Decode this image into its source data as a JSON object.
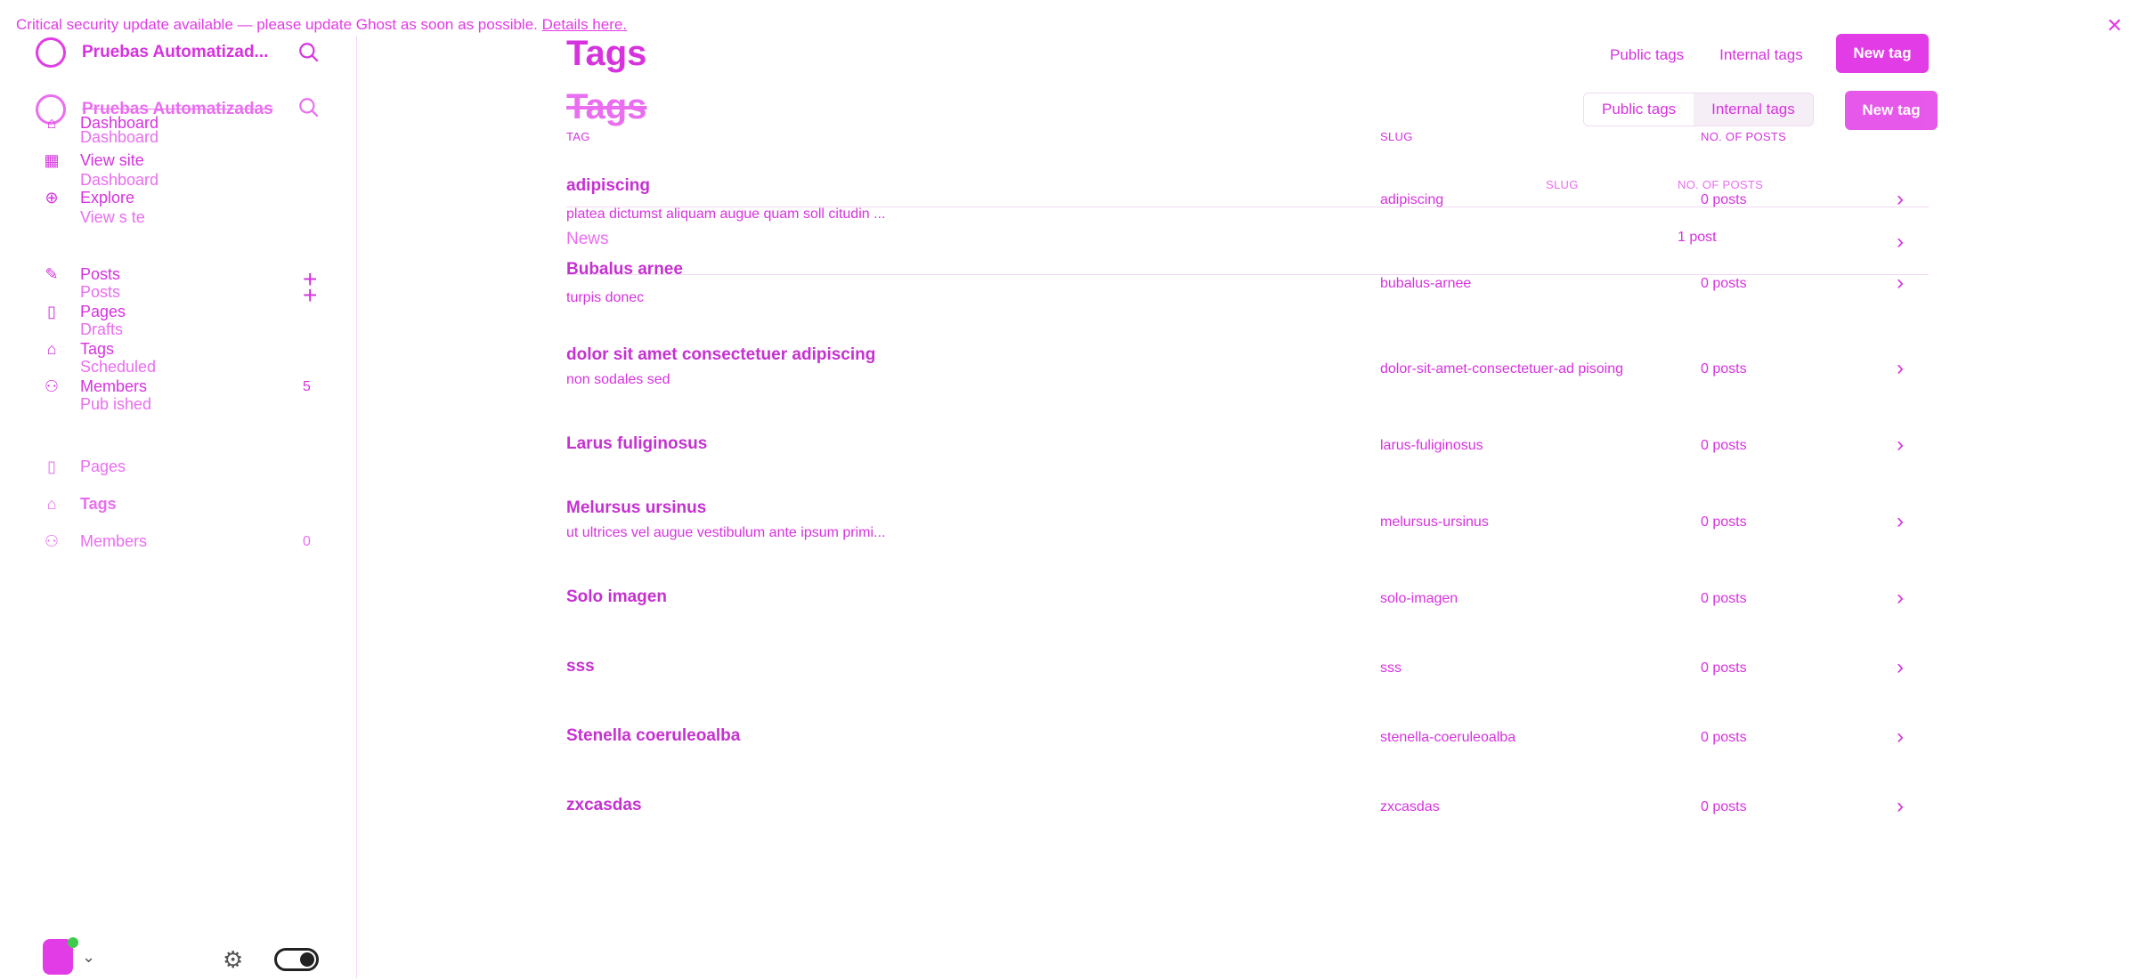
{
  "alert": {
    "text": "Critical security update available — please update Ghost as soon as possible.",
    "link": "Details here.",
    "close": "✕"
  },
  "sidebar": {
    "site_title": "Pruebas Automatizad...",
    "site_title_ghost": "Pruebas Automatizadas",
    "items": [
      {
        "label": "Dashboard"
      },
      {
        "label": "View site"
      },
      {
        "label": "Explore"
      },
      {
        "label": "Posts"
      },
      {
        "label": "Pages"
      },
      {
        "label": "Tags"
      },
      {
        "label": "Members",
        "count": "5"
      }
    ],
    "ghost_items": [
      {
        "label": "Dashboard"
      },
      {
        "label": "Dashboard"
      },
      {
        "label": "View s te"
      },
      {
        "label": "Posts"
      },
      {
        "label": "Drafts"
      },
      {
        "label": "Scheduled"
      },
      {
        "label": "Pub ished"
      },
      {
        "label": "Pages"
      },
      {
        "label": "Tags"
      },
      {
        "label": "Members",
        "count": "0"
      }
    ]
  },
  "main": {
    "title": "Tags",
    "tab_public": "Public tags",
    "tab_internal": "Internal tags",
    "new_tag": "New tag",
    "col_tag": "TAG",
    "col_slug": "SLUG",
    "col_posts": "NO. OF POSTS",
    "ghost_slug": "SLUG",
    "ghost_posts": "NO. OF POSTS",
    "ghost_news": "News",
    "ghost_news_posts": "1 post",
    "rows": [
      {
        "name": "adipiscing",
        "desc": "platea dictumst aliquam augue quam soll citudin ...",
        "slug": "adipiscing",
        "posts": "0 posts"
      },
      {
        "name": "Bubalus arnee",
        "desc": "turpis donec",
        "slug": "bubalus-arnee",
        "posts": "0 posts"
      },
      {
        "name": "dolor sit amet consectetuer adipiscing",
        "desc": "non sodales sed",
        "slug": "dolor-sit-amet-consectetuer-ad pisoing",
        "posts": "0 posts"
      },
      {
        "name": "Larus fuliginosus",
        "desc": "",
        "slug": "larus-fuliginosus",
        "posts": "0 posts"
      },
      {
        "name": "Melursus ursinus",
        "desc": "ut ultrices vel augue vestibulum ante ipsum primi...",
        "slug": "melursus-ursinus",
        "posts": "0 posts"
      },
      {
        "name": "Solo imagen",
        "desc": "",
        "slug": "solo-imagen",
        "posts": "0 posts"
      },
      {
        "name": "sss",
        "desc": "",
        "slug": "sss",
        "posts": "0 posts"
      },
      {
        "name": "Stenella coeruleoalba",
        "desc": "",
        "slug": "stenella-coeruleoalba",
        "posts": "0 posts"
      },
      {
        "name": "zxcasdas",
        "desc": "",
        "slug": "zxcasdas",
        "posts": "0 posts"
      }
    ]
  },
  "colors": {
    "accent": "#e23ce6",
    "online": "#3ccb4c"
  }
}
